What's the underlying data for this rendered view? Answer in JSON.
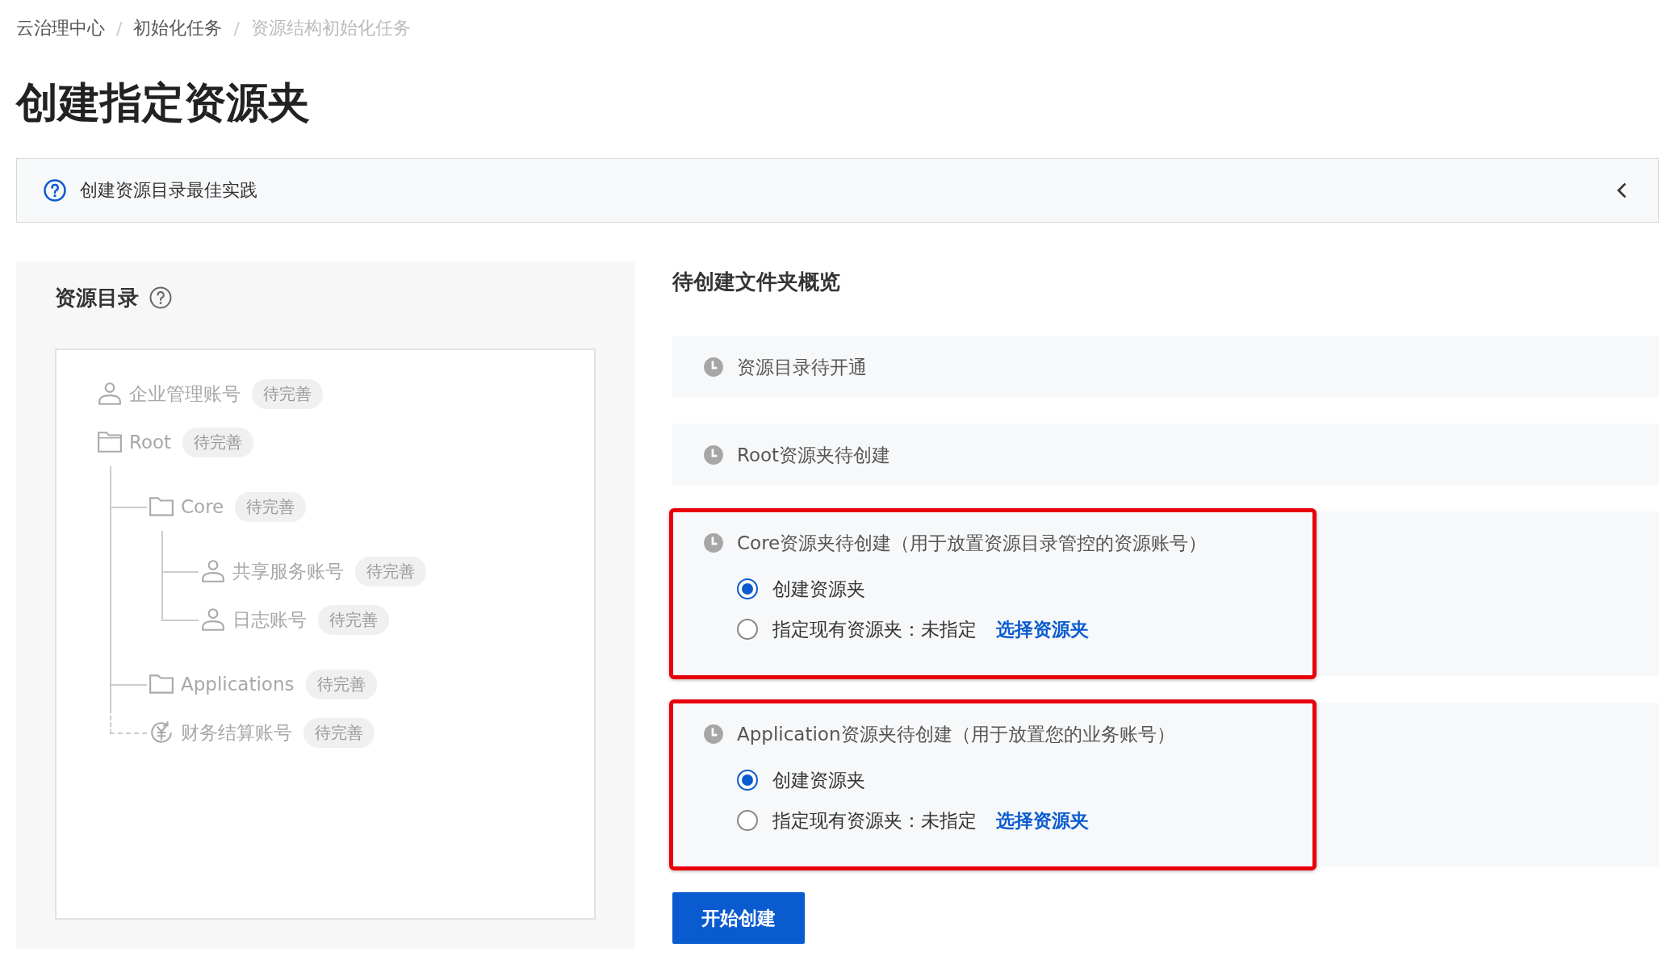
{
  "breadcrumb_separator": "/",
  "breadcrumb": [
    {
      "label": "云治理中心",
      "current": false
    },
    {
      "label": "初始化任务",
      "current": false
    },
    {
      "label": "资源结构初始化任务",
      "current": true
    }
  ],
  "page_title": "创建指定资源夹",
  "tip_bar": {
    "text": "创建资源目录最佳实践",
    "expanded": false
  },
  "directory": {
    "title": "资源目录",
    "tree": [
      {
        "kind": "account",
        "label": "企业管理账号",
        "status": "待完善"
      },
      {
        "kind": "folder",
        "label": "Root",
        "status": "待完善",
        "children": [
          {
            "kind": "folder",
            "label": "Core",
            "status": "待完善",
            "children": [
              {
                "kind": "account",
                "label": "共享服务账号",
                "status": "待完善"
              },
              {
                "kind": "account",
                "label": "日志账号",
                "status": "待完善"
              }
            ]
          },
          {
            "kind": "folder",
            "label": "Applications",
            "status": "待完善"
          },
          {
            "kind": "finance",
            "label": "财务结算账号",
            "status": "待完善"
          }
        ]
      }
    ]
  },
  "overview": {
    "title": "待创建文件夹概览",
    "items": [
      {
        "text": "资源目录待开通",
        "highlighted": false
      },
      {
        "text": "Root资源夹待创建",
        "highlighted": false
      },
      {
        "text": "Core资源夹待创建（用于放置资源目录管控的资源账号）",
        "highlighted": true,
        "options": [
          {
            "label": "创建资源夹",
            "selected": true
          },
          {
            "label": "指定现有资源夹：未指定",
            "link": "选择资源夹",
            "selected": false
          }
        ]
      },
      {
        "text": "Application资源夹待创建（用于放置您的业务账号）",
        "highlighted": true,
        "options": [
          {
            "label": "创建资源夹",
            "selected": true
          },
          {
            "label": "指定现有资源夹：未指定",
            "link": "选择资源夹",
            "selected": false
          }
        ]
      }
    ]
  },
  "start_button": "开始创建"
}
